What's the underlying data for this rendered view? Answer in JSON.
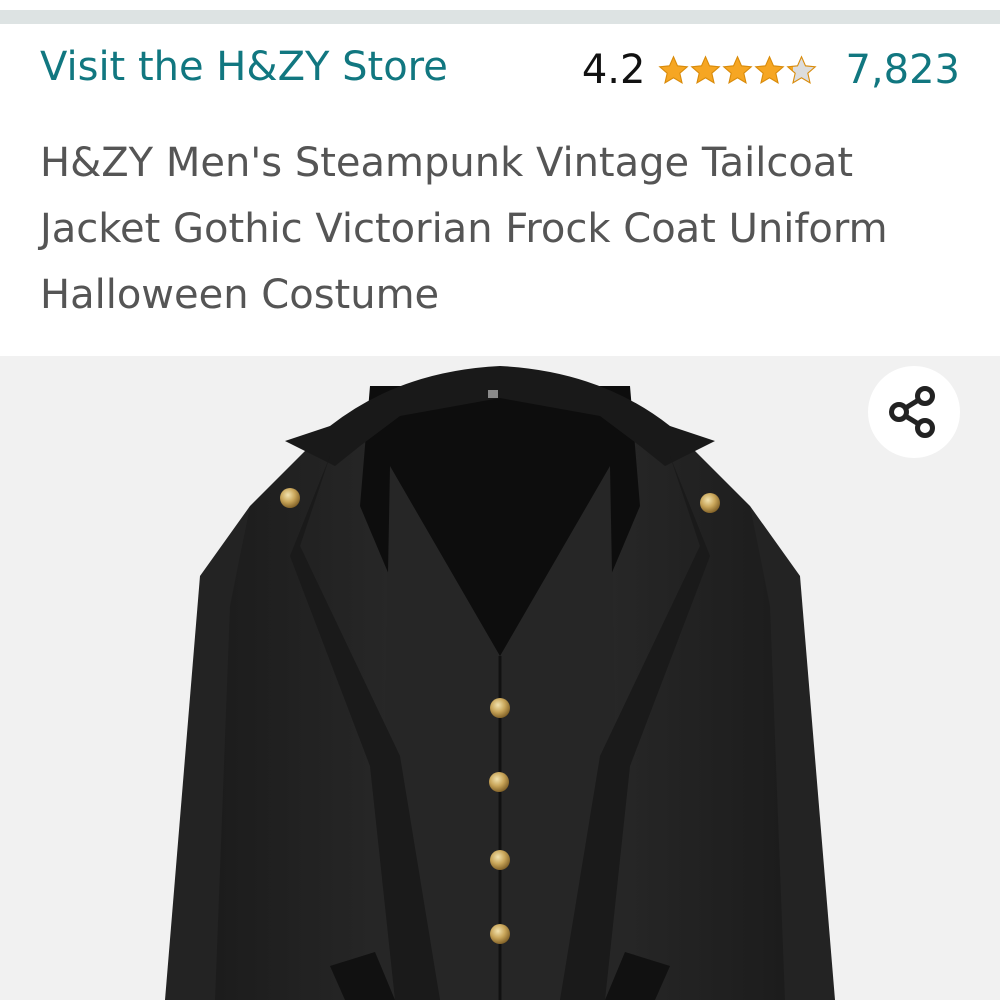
{
  "header": {
    "store_link": "Visit the H&ZY Store",
    "rating": {
      "value": "4.2",
      "stars_filled": 4.2,
      "stars_total": 5,
      "count": "7,823"
    }
  },
  "product": {
    "title": "H&ZY Men's Steampunk Vintage Tailcoat Jacket Gothic Victorian Frock Coat Uniform Halloween Costume"
  },
  "colors": {
    "link": "#117780",
    "star": "#f6a623",
    "star_empty": "#dcdcdc",
    "title": "#555555",
    "image_bg": "#f1f1f1"
  },
  "icons": {
    "share": "share-icon",
    "star": "star-icon"
  }
}
